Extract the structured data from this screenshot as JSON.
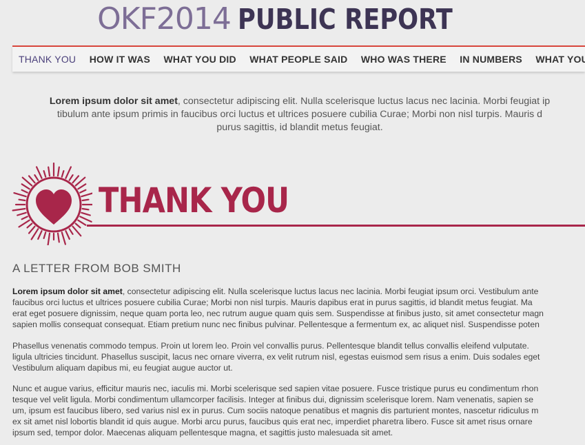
{
  "header": {
    "title_light": "OKF2014",
    "title_bold": "PUBLIC REPORT",
    "colors": {
      "title_light": "#7d6e96",
      "title_bold": "#3d3454",
      "accent": "#d8453b"
    }
  },
  "nav": {
    "items": [
      {
        "label": "THANK YOU",
        "active": true
      },
      {
        "label": "HOW IT WAS"
      },
      {
        "label": "WHAT YOU DID"
      },
      {
        "label": "WHAT PEOPLE SAID"
      },
      {
        "label": "WHO WAS THERE"
      },
      {
        "label": "IN NUMBERS"
      },
      {
        "label": "WHAT YOU C"
      }
    ]
  },
  "intro": {
    "bold": "Lorem ipsum dolor sit amet",
    "line1": ", consectetur adipiscing elit. Nulla scelerisque luctus lacus nec lacinia. Morbi feugiat ip",
    "line2": "tibulum ante ipsum primis in faucibus orci luctus et ultrices posuere cubilia Curae; Morbi non nisl turpis. Mauris d",
    "line3": "purus sagittis, id blandit metus feugiat."
  },
  "thank_you": {
    "heading": "THANK YOU",
    "icon": "heart-burst-icon",
    "color": "#a8264a"
  },
  "letter": {
    "heading": "A LETTER FROM BOB SMITH",
    "p1": {
      "bold": "Lorem ipsum dolor sit amet",
      "line1": ", consectetur adipiscing elit. Nulla scelerisque luctus lacus nec lacinia. Morbi feugiat ipsum orci. Vestibulum ante",
      "line2": "faucibus orci luctus et ultrices posuere cubilia Curae; Morbi non nisl turpis. Mauris dapibus erat in purus sagittis, id blandit metus feugiat. Ma",
      "line3": "erat eget posuere dignissim, neque quam porta leo, nec rutrum augue quam quis sem. Suspendisse at finibus justo, sit amet consectetur magn",
      "line4": "sapien mollis consequat consequat. Etiam pretium nunc nec finibus pulvinar. Pellentesque a fermentum ex, ac aliquet nisl. Suspendisse poten"
    },
    "p2": {
      "line1": " Phasellus venenatis commodo tempus. Proin ut lorem leo. Proin vel convallis purus. Pellentesque blandit tellus convallis eleifend vulputate.",
      "line2": "ligula ultricies tincidunt. Phasellus suscipit, lacus nec ornare viverra, ex velit rutrum nisl, egestas euismod sem risus a enim. Duis sodales eget",
      "line3": "Vestibulum aliquam dapibus mi, eu feugiat augue auctor ut."
    },
    "p3": {
      "line1": "Nunc et augue varius, efficitur mauris nec, iaculis mi. Morbi scelerisque sed sapien vitae posuere. Fusce tristique purus eu condimentum rhon",
      "line2": "tesque vel velit ligula. Morbi condimentum ullamcorper facilisis. Integer at finibus dui, dignissim scelerisque lorem. Nam venenatis, sapien se",
      "line3": "um, ipsum est faucibus libero, sed varius nisl ex in purus. Cum sociis natoque penatibus et magnis dis parturient montes, nascetur ridiculus m",
      "line4": "ex sit amet nisl lobortis blandit id quis augue. Morbi arcu purus, faucibus quis erat nec, imperdiet pharetra libero. Fusce sit amet risus ornare",
      "line5": "ipsum sed, tempor dolor. Maecenas aliquam pellentesque magna, et sagittis justo malesuada sit amet."
    }
  }
}
